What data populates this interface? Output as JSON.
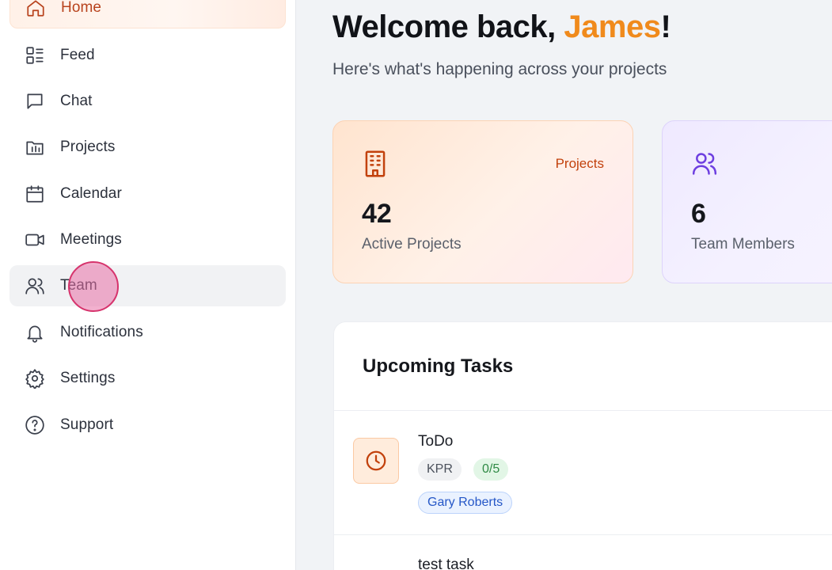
{
  "sidebar": {
    "items": [
      {
        "label": "Home",
        "icon": "home-icon",
        "active": true
      },
      {
        "label": "Feed",
        "icon": "feed-icon"
      },
      {
        "label": "Chat",
        "icon": "chat-icon"
      },
      {
        "label": "Projects",
        "icon": "folder-icon"
      },
      {
        "label": "Calendar",
        "icon": "calendar-icon"
      },
      {
        "label": "Meetings",
        "icon": "video-icon"
      },
      {
        "label": "Team",
        "icon": "users-icon",
        "hover": true
      },
      {
        "label": "Notifications",
        "icon": "bell-icon"
      },
      {
        "label": "Settings",
        "icon": "gear-icon"
      },
      {
        "label": "Support",
        "icon": "help-icon"
      }
    ]
  },
  "header": {
    "greeting_prefix": "Welcome back, ",
    "user_name": "James",
    "greeting_suffix": "!",
    "subtitle": "Here's what's happening across your projects"
  },
  "stats": {
    "projects": {
      "tag": "Projects",
      "value": "42",
      "label": "Active Projects",
      "icon": "building-icon"
    },
    "team": {
      "value": "6",
      "label": "Team Members",
      "icon": "users-icon"
    }
  },
  "tasks": {
    "title": "Upcoming Tasks",
    "items": [
      {
        "title": "ToDo",
        "code": "KPR",
        "progress": "0/5",
        "assignee": "Gary Roberts",
        "icon": "clock-icon"
      },
      {
        "title": "test task"
      }
    ]
  },
  "colors": {
    "accent": "#f08a1c",
    "active_nav": "#b8431d",
    "cursor": "#d6336c"
  }
}
